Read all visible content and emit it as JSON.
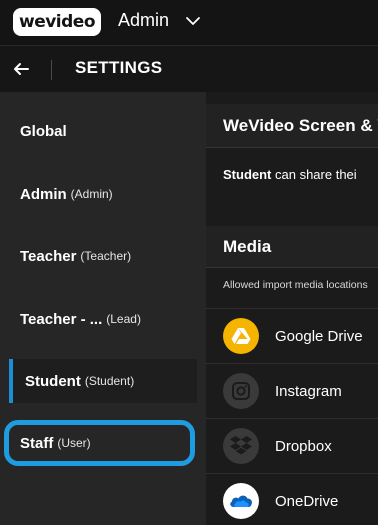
{
  "header": {
    "logo_text": "wevideo",
    "org_name": "Admin"
  },
  "settings_bar": {
    "title": "SETTINGS"
  },
  "sidebar": {
    "items": [
      {
        "name": "Global",
        "role": ""
      },
      {
        "name": "Admin",
        "role": "(Admin)"
      },
      {
        "name": "Teacher",
        "role": "(Teacher)"
      },
      {
        "name": "Teacher - ...",
        "role": "(Lead)"
      },
      {
        "name": "Student",
        "role": "(Student)"
      },
      {
        "name": "Staff",
        "role": "(User)"
      }
    ],
    "active_item": "Student",
    "highlighted_item": "Staff"
  },
  "main": {
    "screen_section": {
      "title": "WeVideo Screen & V",
      "share_bold": "Student",
      "share_rest": " can share thei"
    },
    "media_section": {
      "title": "Media",
      "description": "Allowed import media locations"
    },
    "media_sources": [
      {
        "label": "Google Drive",
        "icon": "google-drive-icon",
        "color": "#f4b400"
      },
      {
        "label": "Instagram",
        "icon": "instagram-icon",
        "color": "#3a3a3a"
      },
      {
        "label": "Dropbox",
        "icon": "dropbox-icon",
        "color": "#3a3a3a"
      },
      {
        "label": "OneDrive",
        "icon": "onedrive-icon",
        "color": "#ffffff"
      }
    ]
  },
  "colors": {
    "accent": "#1f9be0",
    "active_bar": "#1a8fd6"
  }
}
